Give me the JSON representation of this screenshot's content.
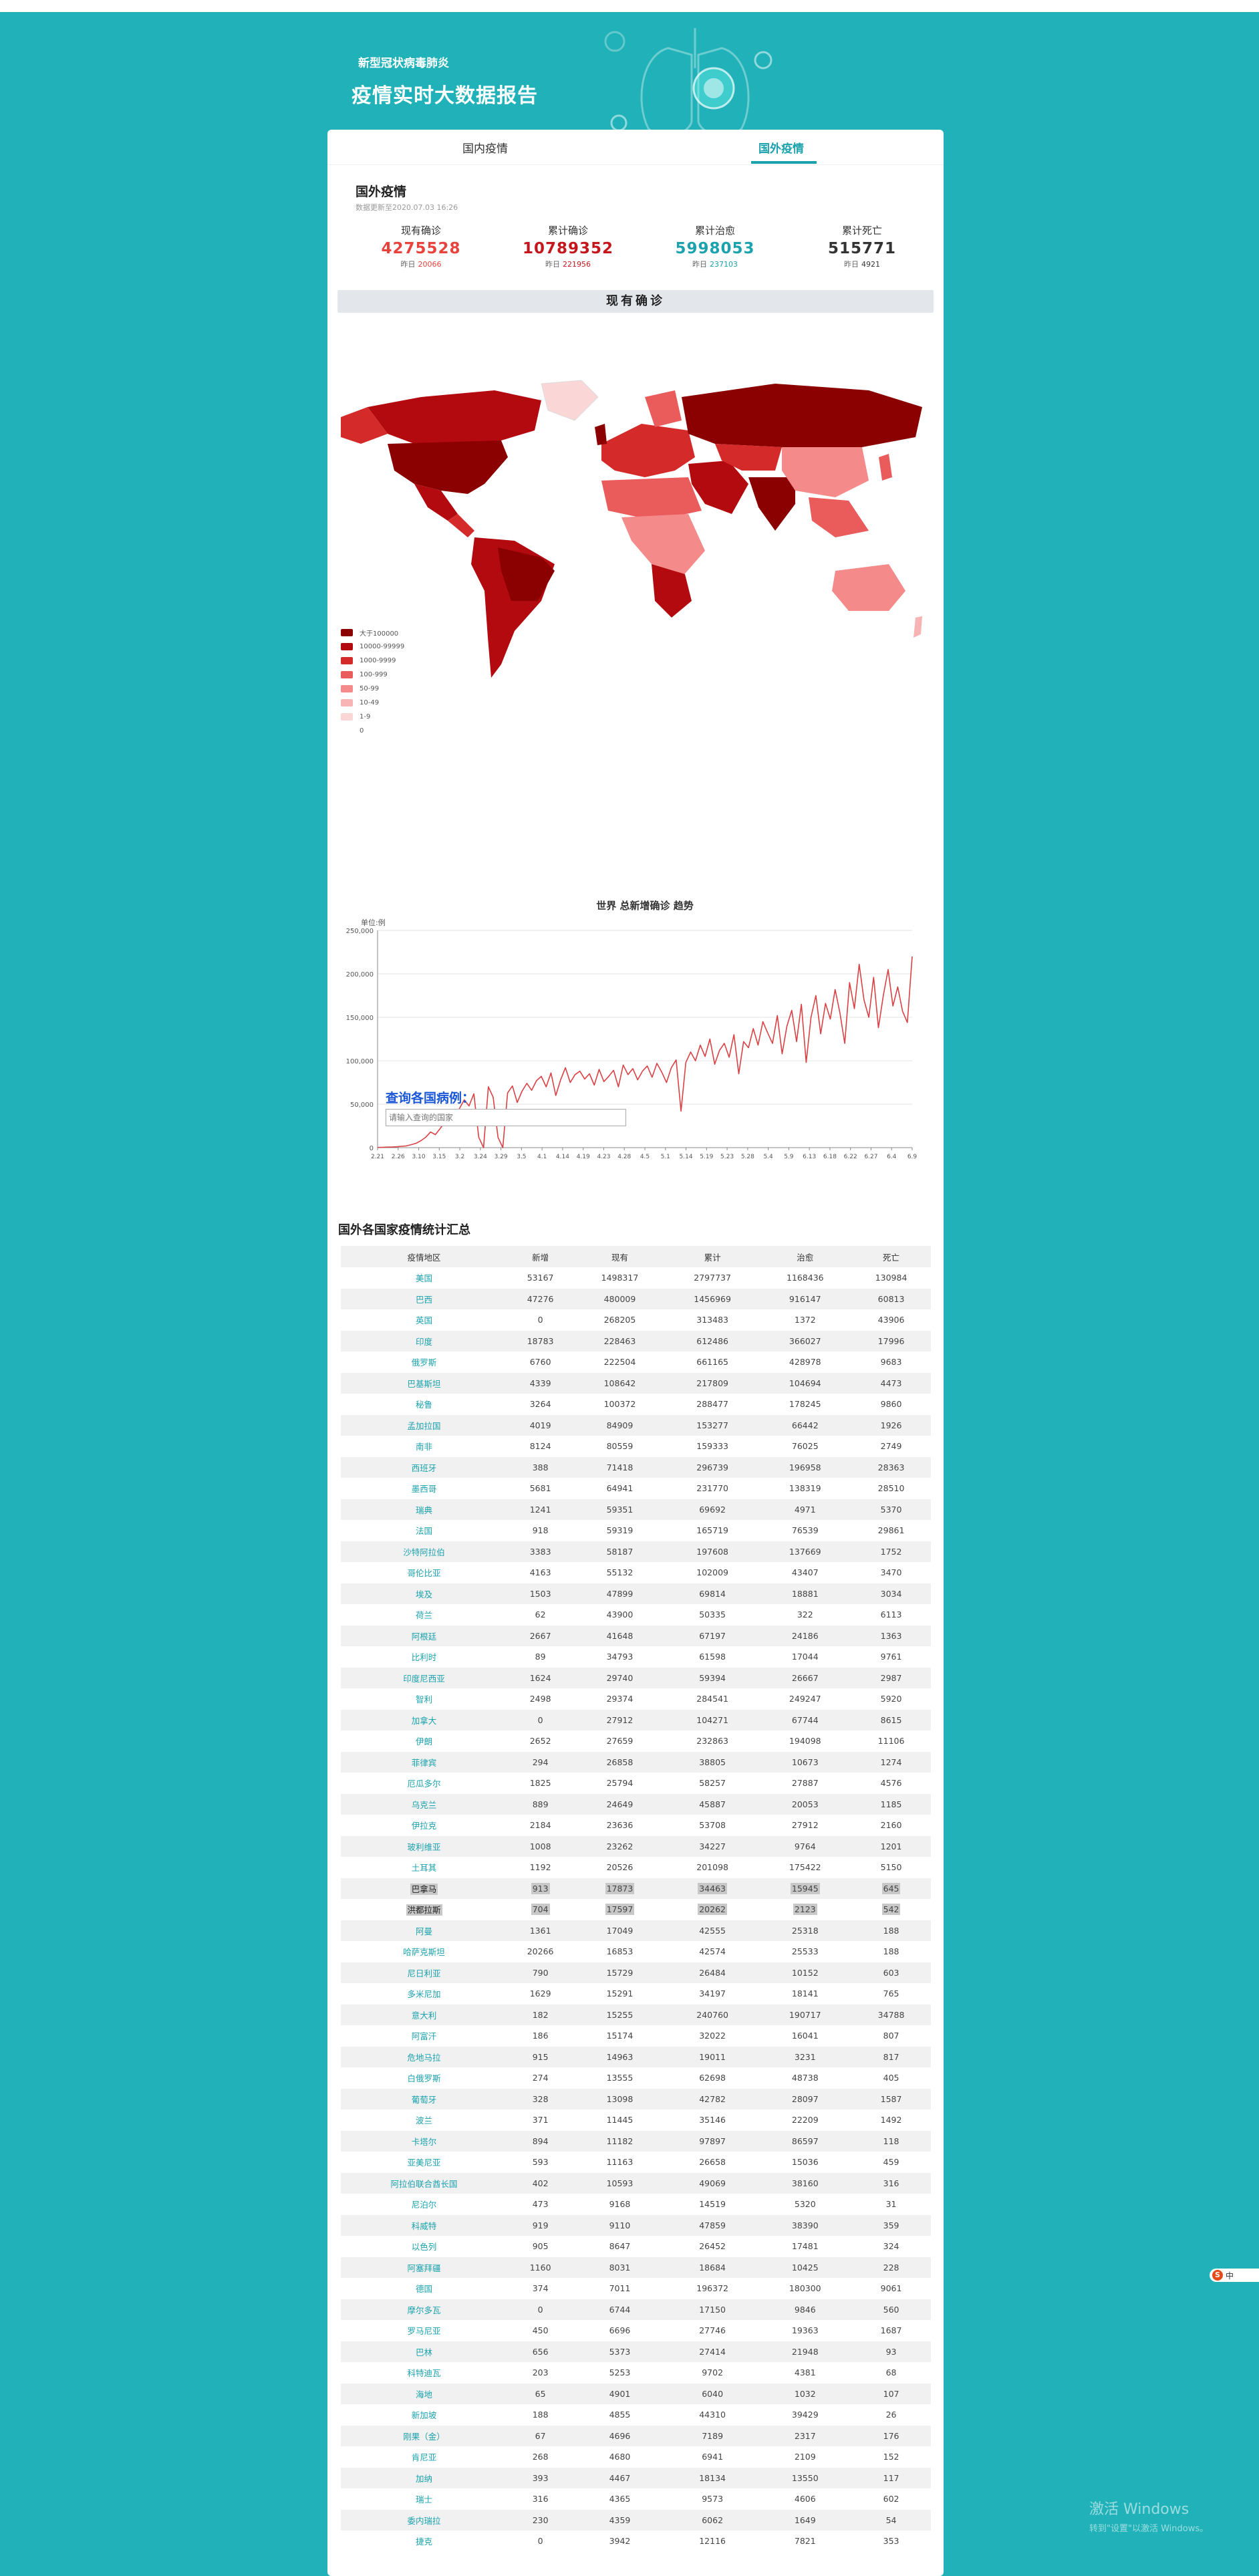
{
  "header": {
    "subtitle": "新型冠状病毒肺炎",
    "title": "疫情实时大数据报告"
  },
  "tabs": [
    "国内疫情",
    "国外疫情"
  ],
  "section": {
    "title": "国外疫情",
    "update_time": "数据更新至2020.07.03 16:26"
  },
  "stats": [
    {
      "label": "现有确诊",
      "value": "4275528",
      "yest_label": "昨日",
      "yest_value": "20066",
      "color": "#e8423d"
    },
    {
      "label": "累计确诊",
      "value": "10789352",
      "yest_label": "昨日",
      "yest_value": "221956",
      "color": "#c5161d"
    },
    {
      "label": "累计治愈",
      "value": "5998053",
      "yest_label": "昨日",
      "yest_value": "237103",
      "color": "#1ba2ad"
    },
    {
      "label": "累计死亡",
      "value": "515771",
      "yest_label": "昨日",
      "yest_value": "4921",
      "color": "#333333"
    }
  ],
  "map_title": "现有确诊",
  "legend": [
    {
      "label": "大于100000",
      "color": "#8b0000"
    },
    {
      "label": "10000-99999",
      "color": "#b30a10"
    },
    {
      "label": "1000-9999",
      "color": "#d42a2a"
    },
    {
      "label": "100-999",
      "color": "#ea5b5b"
    },
    {
      "label": "50-99",
      "color": "#f48a8a"
    },
    {
      "label": "10-49",
      "color": "#f8b4b4"
    },
    {
      "label": "1-9",
      "color": "#fbd6d6"
    },
    {
      "label": "0",
      "color": "#ffffff"
    }
  ],
  "chart_data": {
    "type": "line",
    "title": "世界 总新增确诊 趋势",
    "ylabel": "单位:例",
    "ylim": [
      0,
      250000
    ],
    "yticks": [
      "0",
      "50,000",
      "100,000",
      "150,000",
      "200,000",
      "250,000"
    ],
    "x_labels": [
      "2.21",
      "2.26",
      "3.10",
      "3.15",
      "3.2",
      "3.24",
      "3.29",
      "3.5",
      "4.1",
      "4.14",
      "4.19",
      "4.23",
      "4.28",
      "4.5",
      "5.1",
      "5.14",
      "5.19",
      "5.23",
      "5.28",
      "5.4",
      "5.9",
      "6.13",
      "6.18",
      "6.22",
      "6.27",
      "6.4",
      "6.9"
    ],
    "values": [
      200,
      400,
      600,
      800,
      1000,
      1500,
      2000,
      3500,
      5000,
      8000,
      12000,
      18000,
      15000,
      22000,
      30000,
      38000,
      28000,
      45000,
      55000,
      48000,
      62000,
      12000,
      0,
      70000,
      58000,
      12000,
      0,
      63000,
      71000,
      52000,
      65000,
      74000,
      66000,
      77000,
      82000,
      70000,
      86000,
      60000,
      78000,
      92000,
      75000,
      84000,
      88000,
      79000,
      85000,
      72000,
      90000,
      76000,
      82000,
      89000,
      70000,
      95000,
      84000,
      91000,
      78000,
      88000,
      94000,
      81000,
      97000,
      87000,
      75000,
      92000,
      101000,
      42000,
      98000,
      110000,
      100000,
      118000,
      105000,
      125000,
      96000,
      112000,
      120000,
      104000,
      130000,
      85000,
      122000,
      115000,
      137000,
      118000,
      145000,
      132000,
      120000,
      152000,
      108000,
      140000,
      158000,
      122000,
      165000,
      98000,
      150000,
      175000,
      131000,
      166000,
      148000,
      182000,
      155000,
      120000,
      190000,
      160000,
      211000,
      170000,
      150000,
      196000,
      138000,
      175000,
      205000,
      163000,
      185000,
      157000,
      144000,
      220000
    ]
  },
  "query": {
    "title": "查询各国病例：",
    "placeholder": "请输入查询的国家"
  },
  "table": {
    "title": "国外各国家疫情统计汇总",
    "headers": [
      "疫情地区",
      "新增",
      "现有",
      "累计",
      "治愈",
      "死亡"
    ],
    "rows": [
      [
        "美国",
        "53167",
        "1498317",
        "2797737",
        "1168436",
        "130984"
      ],
      [
        "巴西",
        "47276",
        "480009",
        "1456969",
        "916147",
        "60813"
      ],
      [
        "英国",
        "0",
        "268205",
        "313483",
        "1372",
        "43906"
      ],
      [
        "印度",
        "18783",
        "228463",
        "612486",
        "366027",
        "17996"
      ],
      [
        "俄罗斯",
        "6760",
        "222504",
        "661165",
        "428978",
        "9683"
      ],
      [
        "巴基斯坦",
        "4339",
        "108642",
        "217809",
        "104694",
        "4473"
      ],
      [
        "秘鲁",
        "3264",
        "100372",
        "288477",
        "178245",
        "9860"
      ],
      [
        "孟加拉国",
        "4019",
        "84909",
        "153277",
        "66442",
        "1926"
      ],
      [
        "南非",
        "8124",
        "80559",
        "159333",
        "76025",
        "2749"
      ],
      [
        "西班牙",
        "388",
        "71418",
        "296739",
        "196958",
        "28363"
      ],
      [
        "墨西哥",
        "5681",
        "64941",
        "231770",
        "138319",
        "28510"
      ],
      [
        "瑞典",
        "1241",
        "59351",
        "69692",
        "4971",
        "5370"
      ],
      [
        "法国",
        "918",
        "59319",
        "165719",
        "76539",
        "29861"
      ],
      [
        "沙特阿拉伯",
        "3383",
        "58187",
        "197608",
        "137669",
        "1752"
      ],
      [
        "哥伦比亚",
        "4163",
        "55132",
        "102009",
        "43407",
        "3470"
      ],
      [
        "埃及",
        "1503",
        "47899",
        "69814",
        "18881",
        "3034"
      ],
      [
        "荷兰",
        "62",
        "43900",
        "50335",
        "322",
        "6113"
      ],
      [
        "阿根廷",
        "2667",
        "41648",
        "67197",
        "24186",
        "1363"
      ],
      [
        "比利时",
        "89",
        "34793",
        "61598",
        "17044",
        "9761"
      ],
      [
        "印度尼西亚",
        "1624",
        "29740",
        "59394",
        "26667",
        "2987"
      ],
      [
        "智利",
        "2498",
        "29374",
        "284541",
        "249247",
        "5920"
      ],
      [
        "加拿大",
        "0",
        "27912",
        "104271",
        "67744",
        "8615"
      ],
      [
        "伊朗",
        "2652",
        "27659",
        "232863",
        "194098",
        "11106"
      ],
      [
        "菲律宾",
        "294",
        "26858",
        "38805",
        "10673",
        "1274"
      ],
      [
        "厄瓜多尔",
        "1825",
        "25794",
        "58257",
        "27887",
        "4576"
      ],
      [
        "乌克兰",
        "889",
        "24649",
        "45887",
        "20053",
        "1185"
      ],
      [
        "伊拉克",
        "2184",
        "23636",
        "53708",
        "27912",
        "2160"
      ],
      [
        "玻利维亚",
        "1008",
        "23262",
        "34227",
        "9764",
        "1201"
      ],
      [
        "土耳其",
        "1192",
        "20526",
        "201098",
        "175422",
        "5150"
      ],
      [
        "巴拿马",
        "913",
        "17873",
        "34463",
        "15945",
        "645"
      ],
      [
        "洪都拉斯",
        "704",
        "17597",
        "20262",
        "2123",
        "542"
      ],
      [
        "阿曼",
        "1361",
        "17049",
        "42555",
        "25318",
        "188"
      ],
      [
        "哈萨克斯坦",
        "20266",
        "16853",
        "42574",
        "25533",
        "188"
      ],
      [
        "尼日利亚",
        "790",
        "15729",
        "26484",
        "10152",
        "603"
      ],
      [
        "多米尼加",
        "1629",
        "15291",
        "34197",
        "18141",
        "765"
      ],
      [
        "意大利",
        "182",
        "15255",
        "240760",
        "190717",
        "34788"
      ],
      [
        "阿富汗",
        "186",
        "15174",
        "32022",
        "16041",
        "807"
      ],
      [
        "危地马拉",
        "915",
        "14963",
        "19011",
        "3231",
        "817"
      ],
      [
        "白俄罗斯",
        "274",
        "13555",
        "62698",
        "48738",
        "405"
      ],
      [
        "葡萄牙",
        "328",
        "13098",
        "42782",
        "28097",
        "1587"
      ],
      [
        "波兰",
        "371",
        "11445",
        "35146",
        "22209",
        "1492"
      ],
      [
        "卡塔尔",
        "894",
        "11182",
        "97897",
        "86597",
        "118"
      ],
      [
        "亚美尼亚",
        "593",
        "11163",
        "26658",
        "15036",
        "459"
      ],
      [
        "阿拉伯联合酋长国",
        "402",
        "10593",
        "49069",
        "38160",
        "316"
      ],
      [
        "尼泊尔",
        "473",
        "9168",
        "14519",
        "5320",
        "31"
      ],
      [
        "科威特",
        "919",
        "9110",
        "47859",
        "38390",
        "359"
      ],
      [
        "以色列",
        "905",
        "8647",
        "26452",
        "17481",
        "324"
      ],
      [
        "阿塞拜疆",
        "1160",
        "8031",
        "18684",
        "10425",
        "228"
      ],
      [
        "德国",
        "374",
        "7011",
        "196372",
        "180300",
        "9061"
      ],
      [
        "摩尔多瓦",
        "0",
        "6744",
        "17150",
        "9846",
        "560"
      ],
      [
        "罗马尼亚",
        "450",
        "6696",
        "27746",
        "19363",
        "1687"
      ],
      [
        "巴林",
        "656",
        "5373",
        "27414",
        "21948",
        "93"
      ],
      [
        "科特迪瓦",
        "203",
        "5253",
        "9702",
        "4381",
        "68"
      ],
      [
        "海地",
        "65",
        "4901",
        "6040",
        "1032",
        "107"
      ],
      [
        "新加坡",
        "188",
        "4855",
        "44310",
        "39429",
        "26"
      ],
      [
        "刚果（金）",
        "67",
        "4696",
        "7189",
        "2317",
        "176"
      ],
      [
        "肯尼亚",
        "268",
        "4680",
        "6941",
        "2109",
        "152"
      ],
      [
        "加纳",
        "393",
        "4467",
        "18134",
        "13550",
        "117"
      ],
      [
        "瑞士",
        "316",
        "4365",
        "9573",
        "4606",
        "602"
      ],
      [
        "委内瑞拉",
        "230",
        "4359",
        "6062",
        "1649",
        "54"
      ],
      [
        "捷克",
        "0",
        "3942",
        "12116",
        "7821",
        "353"
      ]
    ]
  },
  "ime_label": "中",
  "watermark": {
    "line1": "激活 Windows",
    "line2": "转到\"设置\"以激活 Windows。"
  }
}
